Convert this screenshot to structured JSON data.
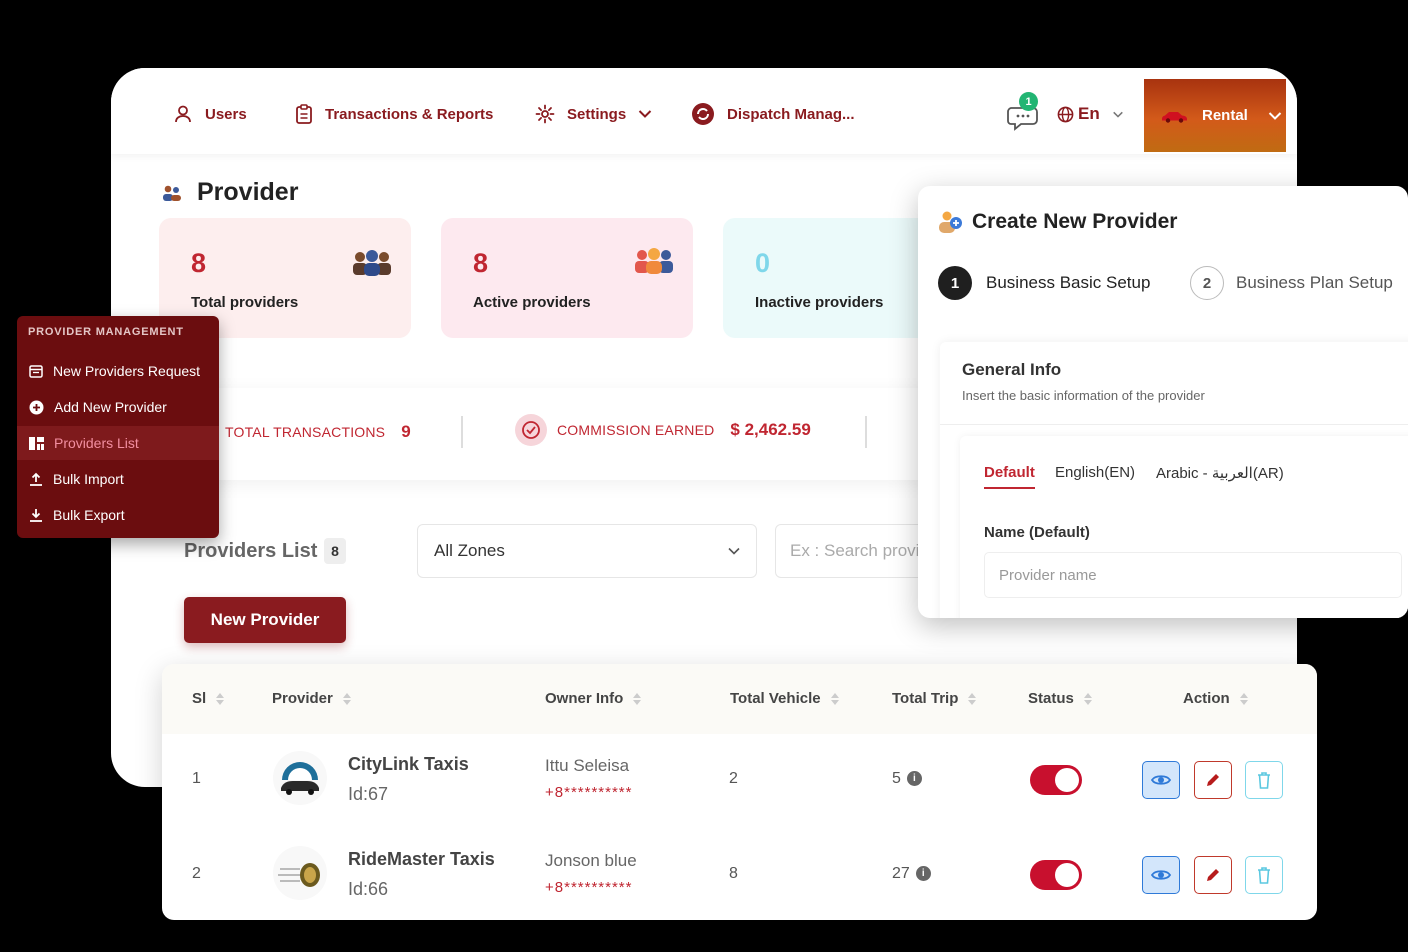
{
  "nav": {
    "users": "Users",
    "transactions": "Transactions & Reports",
    "settings": "Settings",
    "dispatch": "Dispatch Manag...",
    "chat_badge": "1",
    "language": "En",
    "rental": "Rental"
  },
  "page": {
    "title": "Provider"
  },
  "stats": [
    {
      "value": "8",
      "label": "Total providers"
    },
    {
      "value": "8",
      "label": "Active providers"
    },
    {
      "value": "0",
      "label": "Inactive providers"
    }
  ],
  "summary": {
    "total_transactions_label": "TOTAL TRANSACTIONS",
    "total_transactions_value": "9",
    "commission_label": "COMMISSION EARNED",
    "commission_value": "$ 2,462.59"
  },
  "sidebar": {
    "title": "PROVIDER MANAGEMENT",
    "items": [
      {
        "label": "New Providers Request"
      },
      {
        "label": "Add New Provider"
      },
      {
        "label": "Providers List"
      },
      {
        "label": "Bulk Import"
      },
      {
        "label": "Bulk Export"
      }
    ]
  },
  "list": {
    "title": "Providers List",
    "count": "8",
    "zone_selected": "All Zones",
    "search_placeholder": "Ex : Search provider",
    "new_button": "New Provider"
  },
  "panel": {
    "title": "Create New Provider",
    "steps": [
      {
        "num": "1",
        "label": "Business Basic Setup"
      },
      {
        "num": "2",
        "label": "Business Plan Setup"
      }
    ],
    "section_title": "General Info",
    "section_desc": "Insert the basic information of the provider",
    "tabs": [
      "Default",
      "English(EN)",
      "Arabic - العربية(AR)"
    ],
    "name_label": "Name (Default)",
    "name_placeholder": "Provider name"
  },
  "table": {
    "headers": [
      "Sl",
      "Provider",
      "Owner Info",
      "Total Vehicle",
      "Total Trip",
      "Status",
      "Action"
    ],
    "rows": [
      {
        "sl": "1",
        "name": "CityLink Taxis",
        "id": "Id:67",
        "owner": "Ittu Seleisa",
        "phone": "+8**********",
        "vehicles": "2",
        "trips": "5",
        "status": true
      },
      {
        "sl": "2",
        "name": "RideMaster Taxis",
        "id": "Id:66",
        "owner": "Jonson blue",
        "phone": "+8**********",
        "vehicles": "8",
        "trips": "27",
        "status": true
      }
    ]
  },
  "colors": {
    "brand": "#8a1b1f",
    "accent": "#c02631",
    "rental_bar": "#c0541a"
  },
  "icons": [
    "user-icon",
    "clipboard-icon",
    "gear-icon",
    "chevron-down-icon",
    "dispatch-icon",
    "chat-icon",
    "globe-icon",
    "car-icon",
    "group-icon",
    "check-circle-icon",
    "calendar-icon",
    "plus-circle-icon",
    "grid-icon",
    "upload-icon",
    "download-icon",
    "add-user-icon",
    "sort-icon",
    "info-icon",
    "eye-icon",
    "pencil-icon",
    "trash-icon"
  ]
}
